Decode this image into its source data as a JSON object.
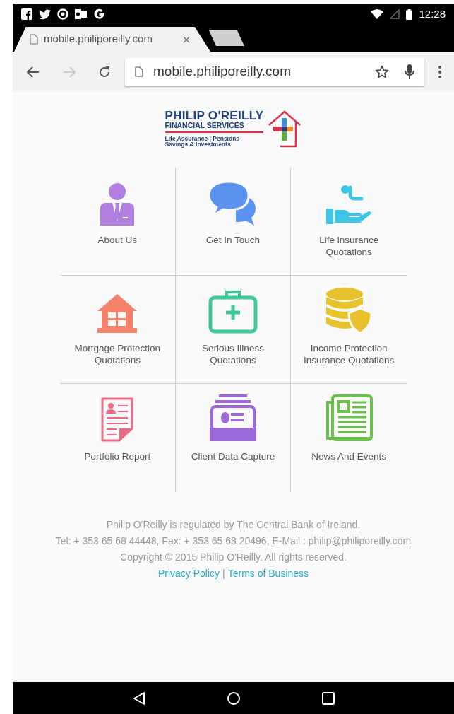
{
  "status_bar": {
    "time": "12:28"
  },
  "tab": {
    "title": "mobile.philiporeilly.com",
    "close": "×"
  },
  "toolbar": {
    "url": "mobile.philiporeilly.com",
    "forward_disabled": true
  },
  "logo": {
    "name": "PHILIP O'REILLY",
    "subtitle": "FINANCIAL SERVICES",
    "tagline_1": "Life Assurance | Pensions",
    "tagline_2": "Savings & Investments"
  },
  "tiles": [
    {
      "lines": [
        "About Us"
      ]
    },
    {
      "lines": [
        "Get In Touch"
      ]
    },
    {
      "lines": [
        "Life insurance",
        "Quotations"
      ]
    },
    {
      "lines": [
        "Mortgage Protection",
        "Quotations"
      ]
    },
    {
      "lines": [
        "Serious Illness",
        "Quotations"
      ]
    },
    {
      "lines": [
        "Income Protection",
        "Insurance Quotations"
      ]
    },
    {
      "lines": [
        "Portfolio Report"
      ]
    },
    {
      "lines": [
        "Client Data Capture"
      ]
    },
    {
      "lines": [
        "News And Events"
      ]
    }
  ],
  "footer": {
    "lines": [
      "Philip O'Reilly is regulated by The Central Bank of Ireland.",
      "Tel: + 353 65 68 44448, Fax: + 353 65 68 20496, E-Mail : philip@philiporeilly.com",
      "Copyright © 2015 Philip O'Reilly. All rights reserved."
    ],
    "links": [
      "Privacy Policy",
      "Terms of Business"
    ],
    "separator": "|"
  }
}
